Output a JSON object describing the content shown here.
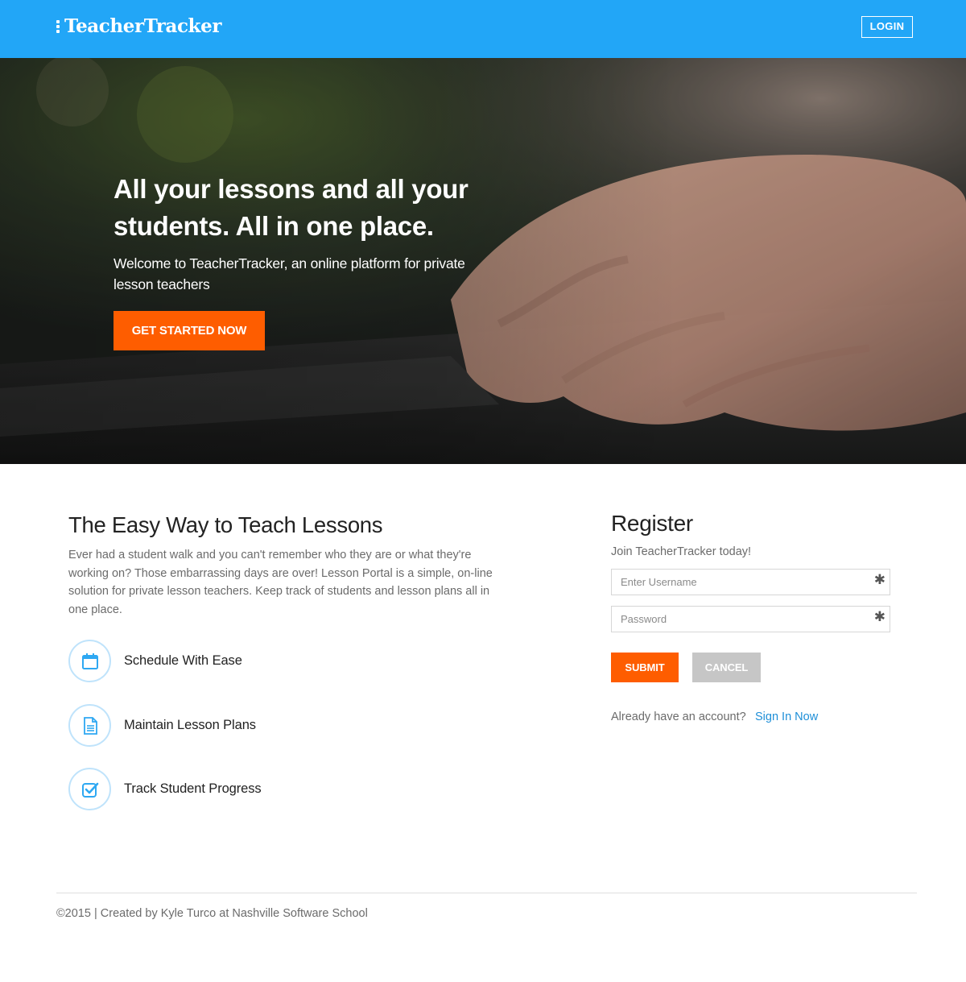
{
  "header": {
    "brand": "TeacherTracker",
    "login_label": "LOGIN"
  },
  "hero": {
    "title": "All your lessons and all your students. All in one place.",
    "subtitle": "Welcome to TeacherTracker, an online platform for private lesson teachers",
    "cta_label": "GET STARTED NOW"
  },
  "features": {
    "title": "The Easy Way to Teach Lessons",
    "description": "Ever had a student walk and you can't remember who they are or what they're working on? Those embarrassing days are over! Lesson Portal is a simple, on-line solution for private lesson teachers. Keep track of students and lesson plans all in one place.",
    "items": [
      {
        "label": "Schedule With Ease",
        "icon": "calendar-icon"
      },
      {
        "label": "Maintain Lesson Plans",
        "icon": "document-icon"
      },
      {
        "label": "Track Student Progress",
        "icon": "checkbox-icon"
      }
    ]
  },
  "register": {
    "title": "Register",
    "subtitle": "Join TeacherTracker today!",
    "username_placeholder": "Enter Username",
    "password_placeholder": "Password",
    "required_mark": "✱",
    "submit_label": "SUBMIT",
    "cancel_label": "CANCEL",
    "already_text": "Already have an account?",
    "signin_label": "Sign In Now"
  },
  "footer": {
    "text": "©2015 | Created by Kyle Turco at Nashville Software School"
  },
  "colors": {
    "header_blue": "#22a6f7",
    "accent_orange": "#fe5d00",
    "cancel_gray": "#c6c6c6",
    "link_blue": "#1e8fd8",
    "icon_blue": "#2ea8f2"
  }
}
